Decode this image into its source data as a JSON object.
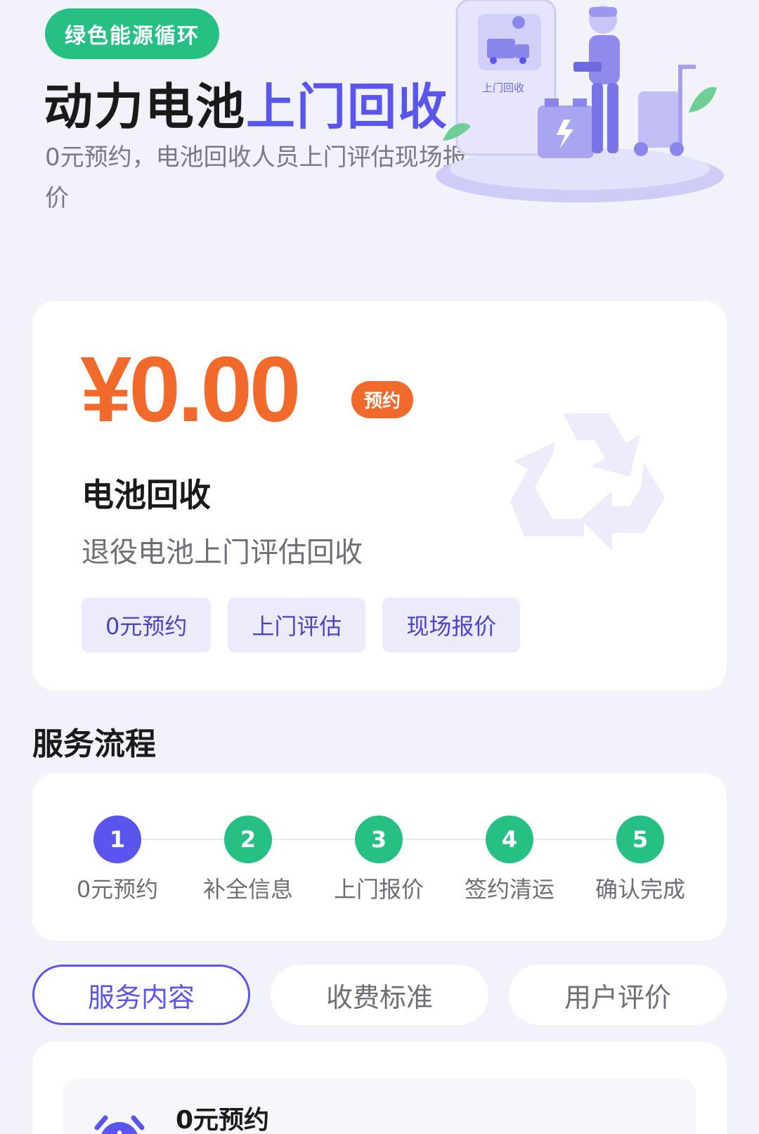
{
  "hero": {
    "tag": "绿色能源循环",
    "title_plain": "动力电池",
    "title_accent": "上门回收",
    "subtitle": "0元预约，电池回收人员上门评估现场报价",
    "art_label": "上门回收"
  },
  "price_card": {
    "price": "¥0.00",
    "badge": "预约",
    "service_name": "电池回收",
    "service_desc": "退役电池上门评估回收",
    "chips": [
      "0元预约",
      "上门评估",
      "现场报价"
    ]
  },
  "flow": {
    "title": "服务流程",
    "steps": [
      {
        "num": "1",
        "label": "0元预约"
      },
      {
        "num": "2",
        "label": "补全信息"
      },
      {
        "num": "3",
        "label": "上门报价"
      },
      {
        "num": "4",
        "label": "签约清运"
      },
      {
        "num": "5",
        "label": "确认完成"
      }
    ]
  },
  "tabs": [
    "服务内容",
    "收费标准",
    "用户评价"
  ],
  "content": {
    "first_item_title": "0元预约"
  },
  "colors": {
    "accent": "#5a55ee",
    "green": "#27c084",
    "orange": "#f26a2b"
  }
}
